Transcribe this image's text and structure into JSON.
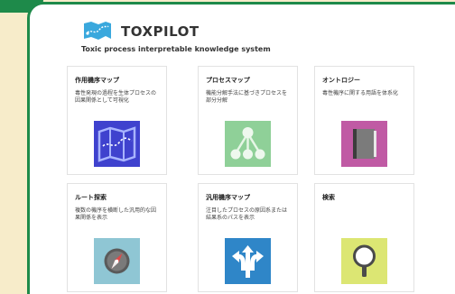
{
  "app": {
    "title": "TOXPILOT",
    "subtitle": "Toxic process interpretable knowledge system"
  },
  "cards": [
    {
      "title": "作用機序マップ",
      "desc": "毒性発現の過程を生体プロセスの因果関係として可視化",
      "icon": "map-icon",
      "color": "#3f42ce"
    },
    {
      "title": "プロセスマップ",
      "desc": "機能分解手法に基づきプロセスを部分分解",
      "icon": "hierarchy-icon",
      "color": "#8fd098"
    },
    {
      "title": "オントロジー",
      "desc": "毒性機序に関する用語を体系化",
      "icon": "book-icon",
      "color": "#c05aa4"
    },
    {
      "title": "ルート探索",
      "desc": "複数の機序を横断した汎用的な因果関係を表示",
      "icon": "compass-icon",
      "color": "#8fc6d4"
    },
    {
      "title": "汎用機序マップ",
      "desc": "注目したプロセスの原因系または結果系のパスを表示",
      "icon": "arrows-icon",
      "color": "#2f86c8"
    },
    {
      "title": "検索",
      "desc": "",
      "icon": "magnifier-icon",
      "color": "#dce673"
    }
  ]
}
